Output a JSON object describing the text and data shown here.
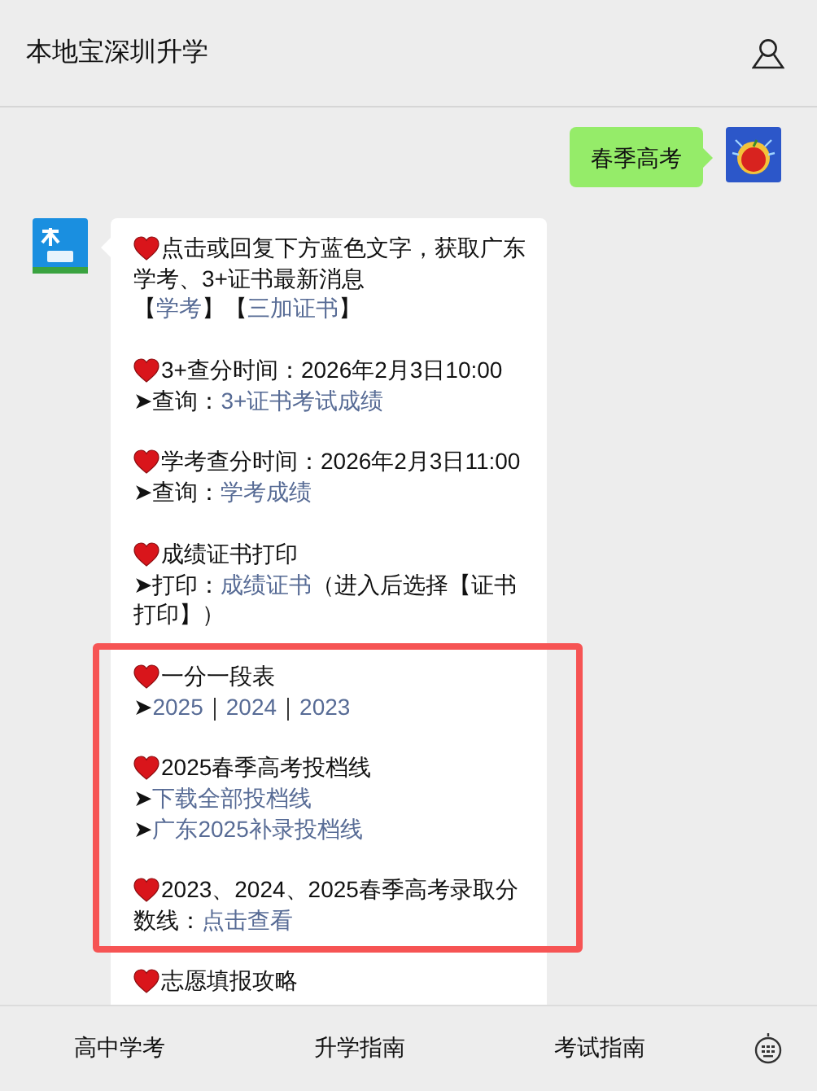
{
  "header": {
    "title": "本地宝深圳升学"
  },
  "sent_message": {
    "text": "春季高考"
  },
  "received_message": {
    "sections": [
      {
        "highlighted": false,
        "groups": [
          {
            "lines": [
              {
                "heart": true,
                "parts": [
                  {
                    "kind": "text",
                    "text": "点击或回复下方蓝色文字，获取广东"
                  }
                ]
              },
              {
                "heart": false,
                "parts": [
                  {
                    "kind": "text",
                    "text": "学考、3+证书最新消息"
                  }
                ]
              },
              {
                "heart": false,
                "parts": [
                  {
                    "kind": "text",
                    "text": "【"
                  },
                  {
                    "kind": "link",
                    "text": "学考"
                  },
                  {
                    "kind": "text",
                    "text": " 】【"
                  },
                  {
                    "kind": "link",
                    "text": "三加证书"
                  },
                  {
                    "kind": "text",
                    "text": " 】"
                  }
                ]
              }
            ]
          }
        ]
      },
      {
        "highlighted": false,
        "groups": [
          {
            "lines": [
              {
                "heart": true,
                "parts": [
                  {
                    "kind": "text",
                    "text": "3+查分时间：2026年2月3日10:00"
                  }
                ]
              },
              {
                "heart": false,
                "parts": [
                  {
                    "kind": "text",
                    "text": "➤查询："
                  },
                  {
                    "kind": "link",
                    "text": "3+证书考试成绩"
                  }
                ]
              }
            ]
          }
        ]
      },
      {
        "highlighted": false,
        "groups": [
          {
            "lines": [
              {
                "heart": true,
                "parts": [
                  {
                    "kind": "text",
                    "text": "学考查分时间：2026年2月3日11:00"
                  }
                ]
              },
              {
                "heart": false,
                "parts": [
                  {
                    "kind": "text",
                    "text": "➤查询："
                  },
                  {
                    "kind": "link",
                    "text": "学考成绩"
                  }
                ]
              }
            ]
          }
        ]
      },
      {
        "highlighted": false,
        "groups": [
          {
            "lines": [
              {
                "heart": true,
                "parts": [
                  {
                    "kind": "text",
                    "text": "成绩证书打印"
                  }
                ]
              },
              {
                "heart": false,
                "parts": [
                  {
                    "kind": "text",
                    "text": "➤打印："
                  },
                  {
                    "kind": "link",
                    "text": "成绩证书"
                  },
                  {
                    "kind": "text",
                    "text": " （进入后选择【证书"
                  }
                ]
              },
              {
                "heart": false,
                "parts": [
                  {
                    "kind": "text",
                    "text": "打印】）"
                  }
                ]
              }
            ]
          }
        ]
      },
      {
        "highlighted": true,
        "groups": [
          {
            "lines": [
              {
                "heart": true,
                "parts": [
                  {
                    "kind": "text",
                    "text": "一分一段表"
                  }
                ]
              },
              {
                "heart": false,
                "parts": [
                  {
                    "kind": "text",
                    "text": "➤"
                  },
                  {
                    "kind": "link",
                    "text": "2025"
                  },
                  {
                    "kind": "text",
                    "text": " ｜"
                  },
                  {
                    "kind": "link",
                    "text": "2024"
                  },
                  {
                    "kind": "text",
                    "text": " ｜"
                  },
                  {
                    "kind": "link",
                    "text": "2023"
                  }
                ]
              }
            ]
          },
          {
            "lines": [
              {
                "heart": true,
                "parts": [
                  {
                    "kind": "text",
                    "text": "2025春季高考投档线"
                  }
                ]
              },
              {
                "heart": false,
                "parts": [
                  {
                    "kind": "text",
                    "text": "➤"
                  },
                  {
                    "kind": "link",
                    "text": "下载全部投档线"
                  }
                ]
              },
              {
                "heart": false,
                "parts": [
                  {
                    "kind": "text",
                    "text": "➤"
                  },
                  {
                    "kind": "link",
                    "text": "广东2025补录投档线"
                  }
                ]
              }
            ]
          },
          {
            "lines": [
              {
                "heart": true,
                "parts": [
                  {
                    "kind": "text",
                    "text": "2023、2024、2025春季高考录取分"
                  }
                ]
              },
              {
                "heart": false,
                "parts": [
                  {
                    "kind": "text",
                    "text": "数线："
                  },
                  {
                    "kind": "link",
                    "text": "点击查看"
                  }
                ]
              }
            ]
          }
        ]
      },
      {
        "highlighted": false,
        "groups": [
          {
            "lines": [
              {
                "heart": true,
                "parts": [
                  {
                    "kind": "text",
                    "text": "志愿填报攻略"
                  }
                ]
              }
            ]
          }
        ]
      }
    ]
  },
  "menu": [
    {
      "label": "高中学考"
    },
    {
      "label": "升学指南"
    },
    {
      "label": "考试指南"
    }
  ]
}
